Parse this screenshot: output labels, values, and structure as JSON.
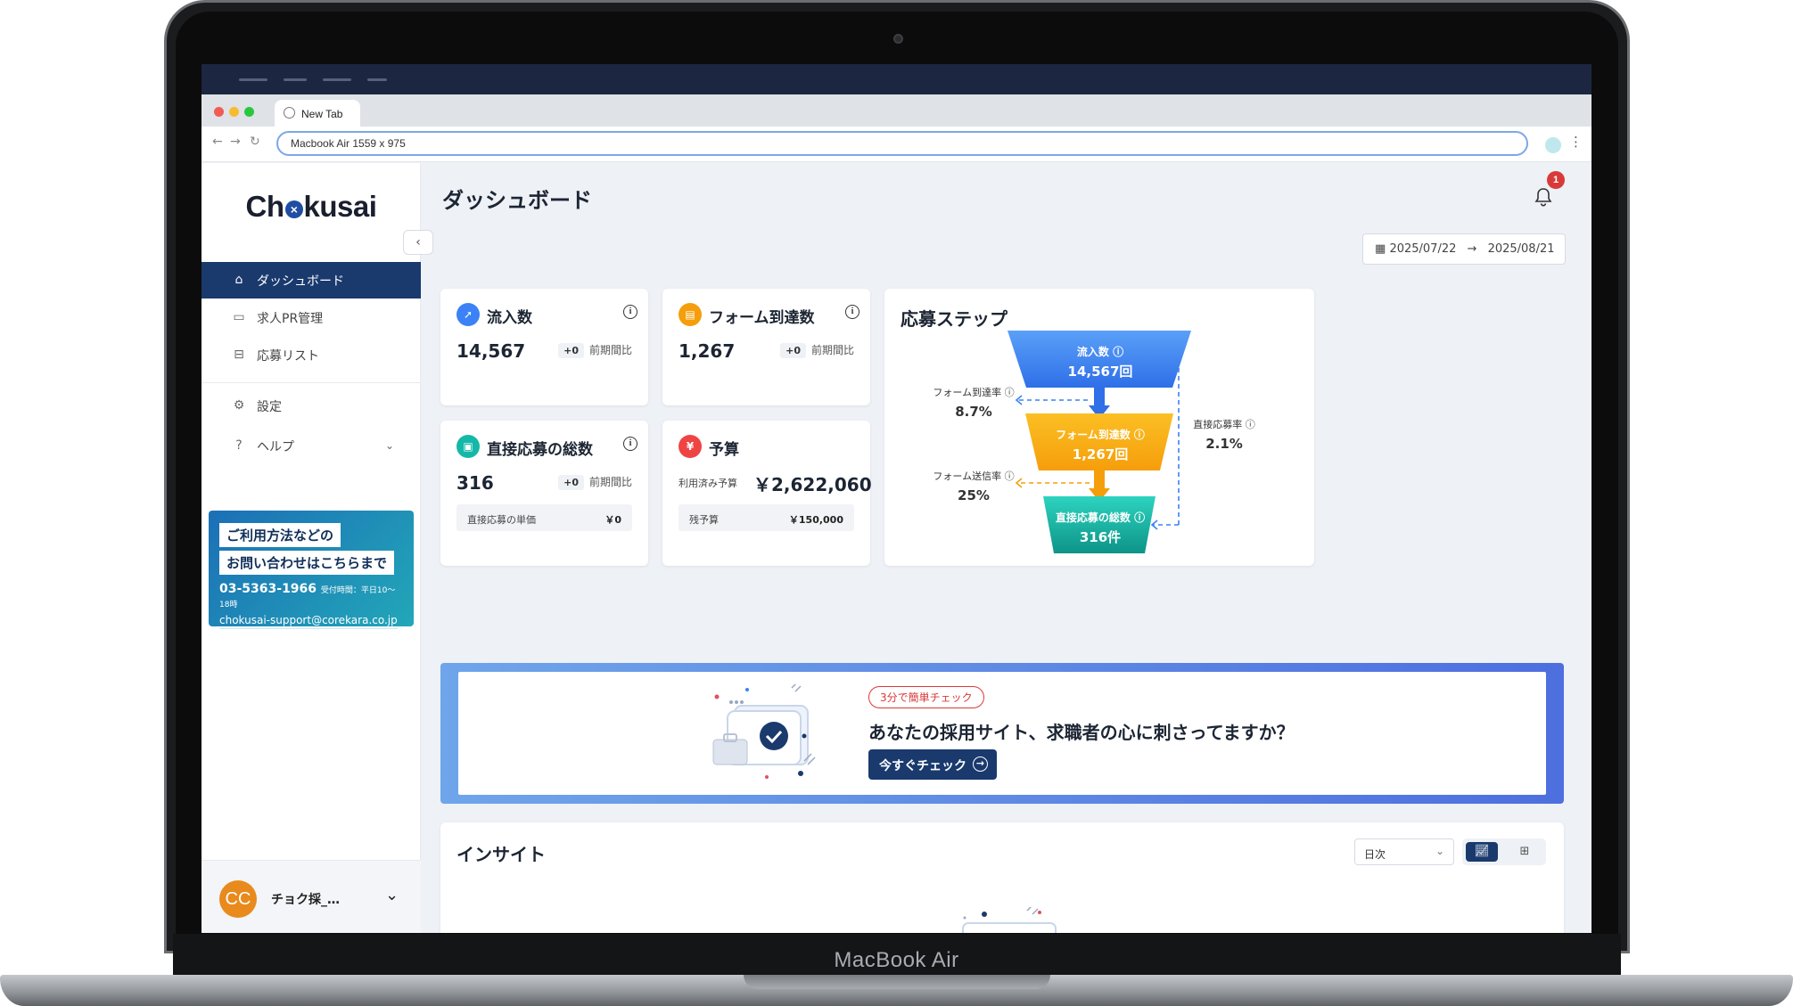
{
  "device": {
    "brand_label": "MacBook Air"
  },
  "browser": {
    "tab_title": "New Tab",
    "url": "Macbook Air   1559 x 975",
    "traffic_colors": [
      "#f25b55",
      "#f8bb2f",
      "#27c83f"
    ]
  },
  "sidebar": {
    "logo": {
      "before": "Ch",
      "after": "kusai",
      "mark": "×"
    },
    "items": [
      {
        "label": "ダッシュボード",
        "icon": "home-icon",
        "active": true
      },
      {
        "label": "求人PR管理",
        "icon": "briefcase-icon",
        "active": false
      },
      {
        "label": "応募リスト",
        "icon": "inbox-icon",
        "active": false
      },
      {
        "label": "設定",
        "icon": "gear-icon",
        "active": false
      },
      {
        "label": "ヘルプ",
        "icon": "help-icon",
        "active": false
      }
    ],
    "contact": {
      "line1": "ご利用方法などの",
      "line2": "お問い合わせはこちらまで",
      "phone": "03-5363-1966",
      "hours": "受付時間：平日10〜18時",
      "email": "chokusai-support@corekara.co.jp"
    },
    "user": {
      "initials": "CC",
      "name": "チョク採_…"
    }
  },
  "header": {
    "title": "ダッシュボード",
    "notification_count": "1",
    "date_from": "2025/07/22",
    "date_arrow": "→",
    "date_to": "2025/08/21"
  },
  "stats": {
    "inflow": {
      "title": "流入数",
      "value": "14,567",
      "delta": "+0",
      "delta_label": "前期間比",
      "color": "#3b82f6"
    },
    "form_reach": {
      "title": "フォーム到達数",
      "value": "1,267",
      "delta": "+0",
      "delta_label": "前期間比",
      "color": "#f59e0b"
    },
    "direct_apply": {
      "title": "直接応募の総数",
      "value": "316",
      "delta": "+0",
      "delta_label": "前期間比",
      "color": "#14b8a6",
      "sub_label": "直接応募の単価",
      "sub_value": "￥0"
    },
    "budget": {
      "title": "予算",
      "used_label": "利用済み予算",
      "used_value": "￥2,622,060",
      "remain_label": "残予算",
      "remain_value": "￥150,000",
      "color": "#ef4444"
    }
  },
  "funnel": {
    "title": "応募ステップ",
    "stages": [
      {
        "label": "流入数",
        "value": "14,567回",
        "color": "#3b82f6"
      },
      {
        "label": "フォーム到達数",
        "value": "1,267回",
        "color": "#f59e0b"
      },
      {
        "label": "直接応募の総数",
        "value": "316件",
        "color": "#14b8a6"
      }
    ],
    "rates": {
      "form_reach_rate": {
        "label": "フォーム到達率",
        "value": "8.7%"
      },
      "form_submit_rate": {
        "label": "フォーム送信率",
        "value": "25%"
      },
      "direct_apply_rate": {
        "label": "直接応募率",
        "value": "2.1%"
      }
    }
  },
  "banner": {
    "pill": "3分で簡単チェック",
    "message": "あなたの採用サイト、求職者の心に刺さってますか？",
    "button": "今すぐチェック"
  },
  "insight": {
    "title": "インサイト",
    "period_select": "日次",
    "view_modes": [
      "chart-view",
      "table-view"
    ]
  }
}
